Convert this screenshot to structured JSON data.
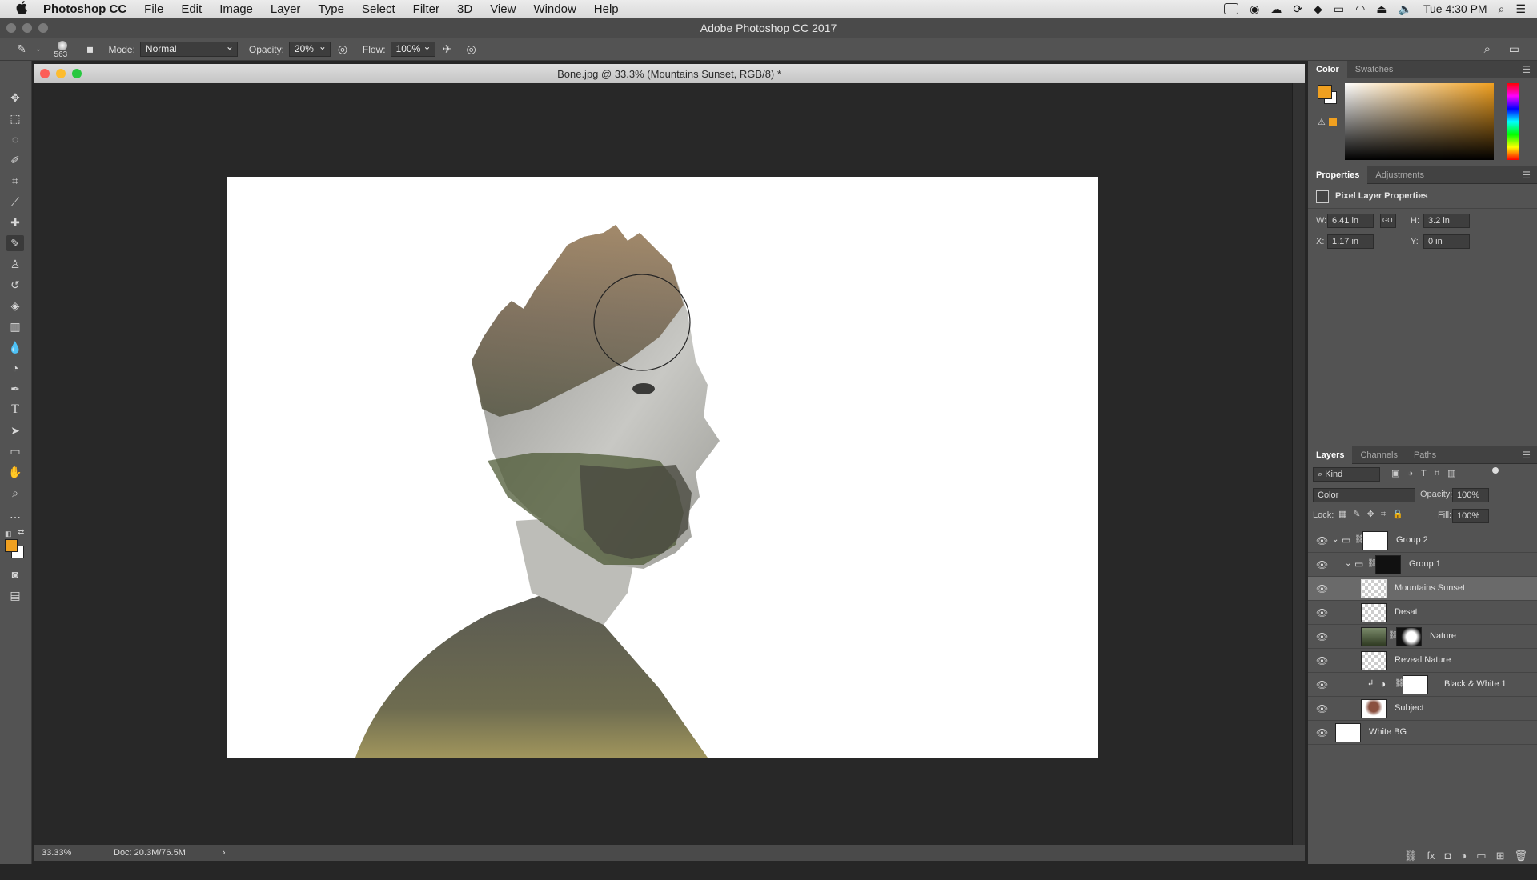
{
  "menubar": {
    "apple": "",
    "app_name": "Photoshop CC",
    "menus": [
      "File",
      "Edit",
      "Image",
      "Layer",
      "Type",
      "Select",
      "Filter",
      "3D",
      "View",
      "Window",
      "Help"
    ],
    "clock": "Tue 4:30 PM"
  },
  "app_title": "Adobe Photoshop CC 2017",
  "options": {
    "brush_size": "563",
    "mode_label": "Mode:",
    "mode_value": "Normal",
    "opacity_label": "Opacity:",
    "opacity_value": "20%",
    "flow_label": "Flow:",
    "flow_value": "100%"
  },
  "document": {
    "title": "Bone.jpg @ 33.3% (Mountains Sunset, RGB/8) *",
    "zoom": "33.33%",
    "doc_size": "Doc: 20.3M/76.5M"
  },
  "color_panel": {
    "tabs": [
      "Color",
      "Swatches"
    ],
    "foreground": "#f0a020",
    "background": "#ffffff"
  },
  "properties_panel": {
    "tabs": [
      "Properties",
      "Adjustments"
    ],
    "heading": "Pixel Layer Properties",
    "w_label": "W:",
    "w_value": "6.41 in",
    "h_label": "H:",
    "h_value": "3.2 in",
    "x_label": "X:",
    "x_value": "1.17 in",
    "y_label": "Y:",
    "y_value": "0 in",
    "link_label": "GO"
  },
  "layers_panel": {
    "tabs": [
      "Layers",
      "Channels",
      "Paths"
    ],
    "filter_value": "Kind",
    "blend_mode": "Color",
    "opacity_label": "Opacity:",
    "opacity_value": "100%",
    "lock_label": "Lock:",
    "fill_label": "Fill:",
    "fill_value": "100%",
    "layers": [
      {
        "name": "Group 2"
      },
      {
        "name": "Group 1"
      },
      {
        "name": "Mountains Sunset"
      },
      {
        "name": "Desat"
      },
      {
        "name": "Nature"
      },
      {
        "name": "Reveal Nature"
      },
      {
        "name": "Black & White 1"
      },
      {
        "name": "Subject"
      },
      {
        "name": "White BG"
      }
    ]
  }
}
